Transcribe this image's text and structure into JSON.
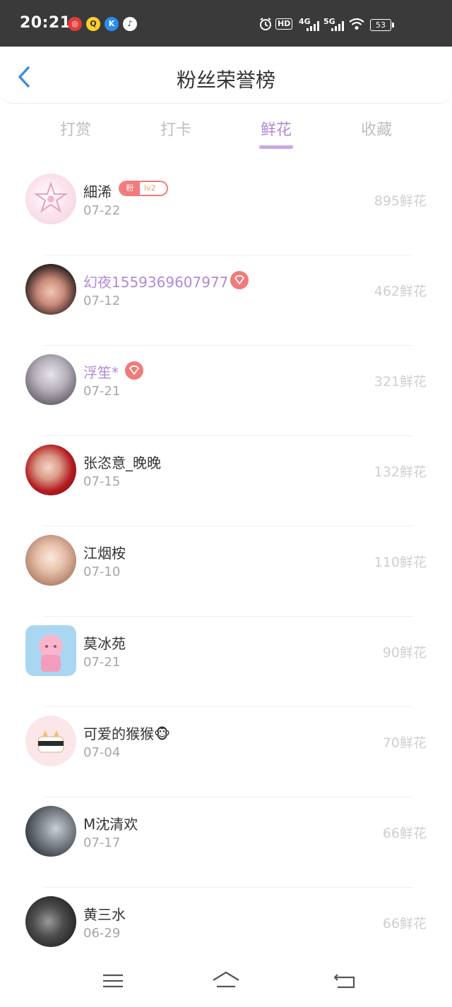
{
  "status_bar": {
    "time": "20:21",
    "battery": "53",
    "network_labels": [
      "HD",
      "4G",
      "5G"
    ],
    "notification_icons": [
      "netease-music-icon",
      "qq-icon",
      "kugou-icon",
      "tiktok-icon"
    ],
    "system_icons": [
      "alarm-icon",
      "signal-4g-icon",
      "signal-5g-icon",
      "wifi-icon",
      "battery-icon"
    ]
  },
  "header": {
    "title": "粉丝荣誉榜",
    "back_icon": "chevron-left-icon"
  },
  "tabs": [
    {
      "label": "打赏",
      "active": false
    },
    {
      "label": "打卡",
      "active": false
    },
    {
      "label": "鲜花",
      "active": true
    },
    {
      "label": "收藏",
      "active": false
    }
  ],
  "fan_badge": {
    "label": "粉",
    "level": "lv2"
  },
  "rows": [
    {
      "name": "細浠",
      "date": "07-22",
      "amount": "895鲜花",
      "vip": false
    },
    {
      "name": "幻夜1559369607977",
      "date": "07-12",
      "amount": "462鲜花",
      "vip": true
    },
    {
      "name": "浮笙*",
      "date": "07-21",
      "amount": "321鲜花",
      "vip": true
    },
    {
      "name": "张恣意_晚晚",
      "date": "07-15",
      "amount": "132鲜花",
      "vip": false
    },
    {
      "name": "江烟桉",
      "date": "07-10",
      "amount": "110鲜花",
      "vip": false
    },
    {
      "name": "莫冰苑",
      "date": "07-21",
      "amount": "90鲜花",
      "vip": false
    },
    {
      "name": "可爱的猴猴🐵",
      "date": "07-04",
      "amount": "70鲜花",
      "vip": false
    },
    {
      "name": "M沈清欢",
      "date": "07-17",
      "amount": "66鲜花",
      "vip": false
    },
    {
      "name": "黄三水",
      "date": "06-29",
      "amount": "66鲜花",
      "vip": false
    }
  ],
  "colors": {
    "accent": "#b18ad6",
    "badge": "#f17c7c",
    "amount_text": "#cfcfcf",
    "status_bar": "#3a3a3a"
  },
  "nav_bar": [
    "menu-icon",
    "home-icon",
    "back-icon"
  ]
}
